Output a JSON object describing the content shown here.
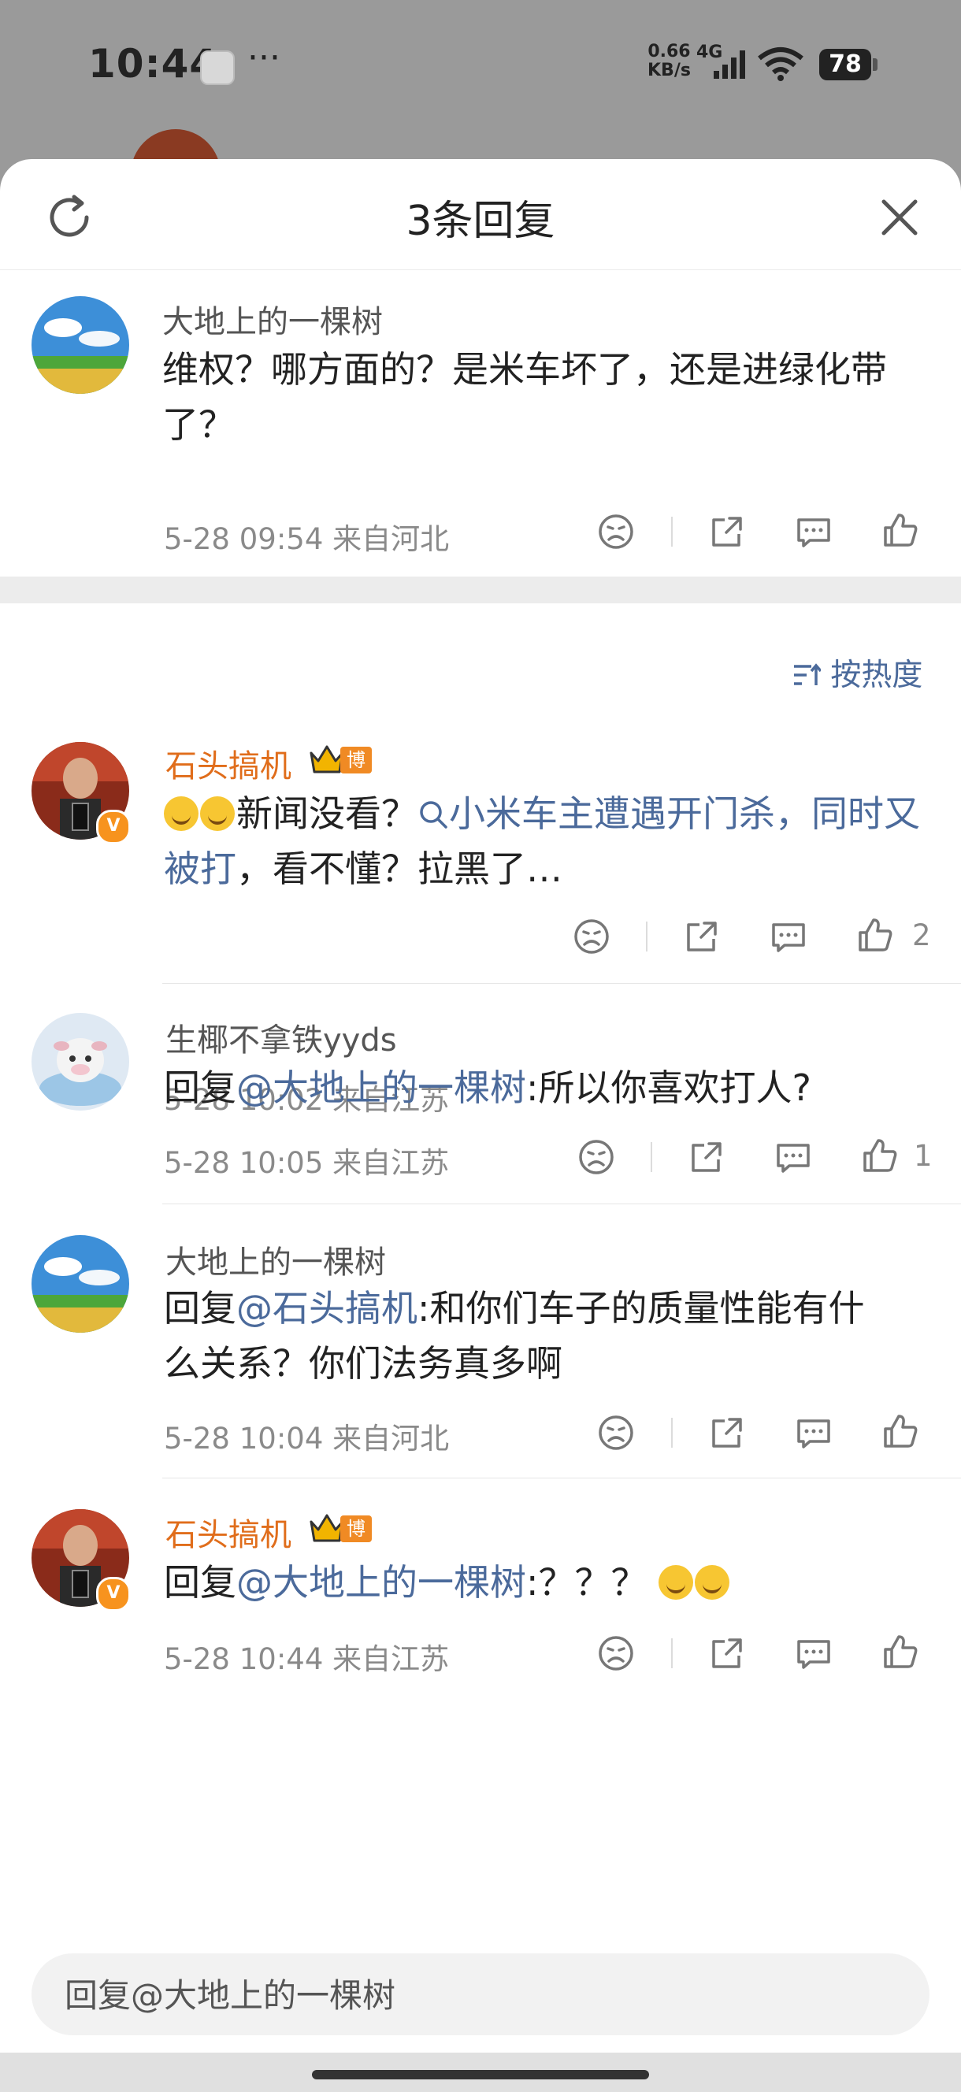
{
  "status_bar": {
    "time": "10:44",
    "speed_value": "0.66",
    "speed_unit": "KB/s",
    "network": "4G",
    "battery": "78"
  },
  "sheet": {
    "title": "3条回复",
    "root": {
      "user": "大地上的一棵树",
      "text": "维权？哪方面的？是米车坏了，还是进绿化带了？",
      "time": "5-28 09:54",
      "location": "来自河北"
    },
    "sort_label": "按热度",
    "replies": [
      {
        "user": "石头搞机",
        "badge": "博主",
        "text_a": "新闻没看？",
        "search_link": "小米车主遭遇开门杀，同时又被打",
        "text_b": "，看不懂？拉黑了…",
        "time": "5-28 10:02",
        "location": "来自江苏",
        "likes": "2"
      },
      {
        "user": "生椰不拿铁yyds",
        "prefix": "回复",
        "mention": "@大地上的一棵树",
        "text": ":所以你喜欢打人?",
        "time": "5-28 10:05",
        "location": "来自江苏",
        "likes": "1"
      },
      {
        "user": "大地上的一棵树",
        "prefix": "回复",
        "mention": "@石头搞机",
        "text_line1": ":和你们车子的质量性能有什",
        "text_line2": "么关系？你们法务真多啊",
        "time": "5-28 10:04",
        "location": "来自河北"
      },
      {
        "user": "石头搞机",
        "badge": "博主",
        "prefix": "回复",
        "mention": "@大地上的一棵树",
        "text": ":？？？",
        "time": "5-28 10:44",
        "location": "来自江苏"
      }
    ],
    "reply_placeholder": "回复@大地上的一棵树"
  },
  "colors": {
    "accent_link": "#4b6a9b",
    "blogger_name": "#e06d1b",
    "badge_orange": "#f08a24"
  },
  "icons": [
    "refresh-icon",
    "close-icon",
    "dislike-icon",
    "share-icon",
    "comment-icon",
    "like-icon",
    "search-icon",
    "sort-icon",
    "crown-icon",
    "verified-icon",
    "emoji-icon"
  ]
}
